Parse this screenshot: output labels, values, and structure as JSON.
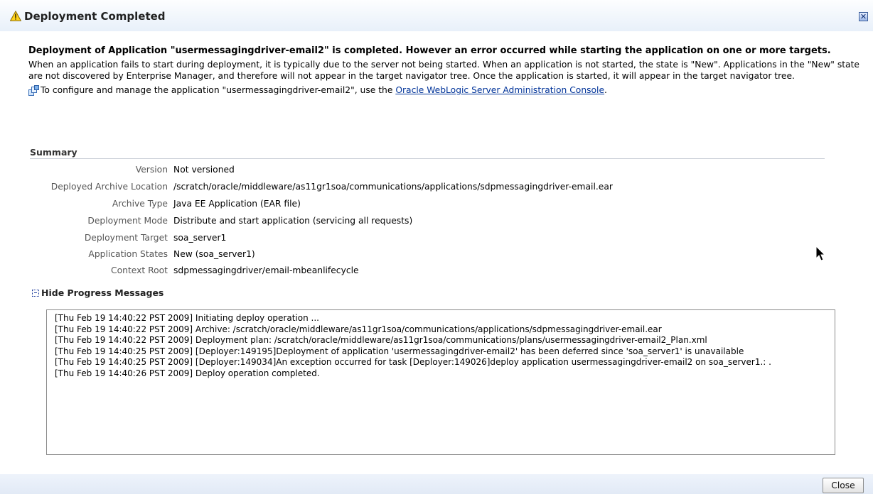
{
  "dialog": {
    "title": "Deployment Completed",
    "close_icon_glyph": "✕"
  },
  "message": {
    "headline": "Deployment of Application \"usermessagingdriver-email2\" is completed. However an error occurred while starting the application on one or more targets.",
    "description": "When an application fails to start during deployment, it is typically due to the server not being started. When an application is not started, the state is \"New\". Applications in the \"New\" state are not discovered by Enterprise Manager, and therefore will not appear in the target navigator tree. Once the application is started, it will appear in the target navigator tree.",
    "configure_prefix": "To configure and manage the application \"usermessagingdriver-email2\", use the ",
    "configure_link": "Oracle WebLogic Server Administration Console",
    "configure_suffix": "."
  },
  "summary": {
    "title": "Summary",
    "rows": [
      {
        "label": "Version",
        "value": "Not versioned"
      },
      {
        "label": "Deployed Archive Location",
        "value": "/scratch/oracle/middleware/as11gr1soa/communications/applications/sdpmessagingdriver-email.ear"
      },
      {
        "label": "Archive Type",
        "value": "Java EE Application (EAR file)"
      },
      {
        "label": "Deployment Mode",
        "value": "Distribute and start application (servicing all requests)"
      },
      {
        "label": "Deployment Target",
        "value": "soa_server1"
      },
      {
        "label": "Application States",
        "value": "New (soa_server1)"
      },
      {
        "label": "Context Root",
        "value": "sdpmessagingdriver/email-mbeanlifecycle"
      }
    ]
  },
  "progress": {
    "toggle_label": "Hide Progress Messages",
    "lines": [
      "[Thu Feb 19 14:40:22 PST 2009] Initiating deploy operation ...",
      "[Thu Feb 19 14:40:22 PST 2009] Archive: /scratch/oracle/middleware/as11gr1soa/communications/applications/sdpmessagingdriver-email.ear",
      "[Thu Feb 19 14:40:22 PST 2009] Deployment plan: /scratch/oracle/middleware/as11gr1soa/communications/plans/usermessagingdriver-email2_Plan.xml",
      "[Thu Feb 19 14:40:25 PST 2009] [Deployer:149195]Deployment of application 'usermessagingdriver-email2' has been deferred since 'soa_server1' is unavailable",
      "[Thu Feb 19 14:40:25 PST 2009] [Deployer:149034]An exception occurred for task [Deployer:149026]deploy application usermessagingdriver-email2 on soa_server1.: .",
      "[Thu Feb 19 14:40:26 PST 2009] Deploy operation completed."
    ]
  },
  "footer": {
    "close_label": "Close"
  },
  "icons": {
    "title": "warning-icon",
    "configure": "application-console-icon",
    "toggle": "collapse-icon",
    "close": "close-icon"
  }
}
